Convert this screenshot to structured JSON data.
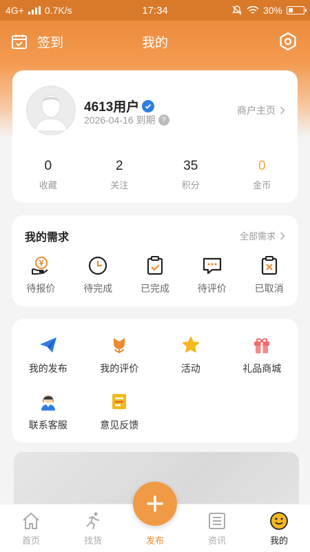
{
  "status_bar": {
    "network": "4G+",
    "speed": "0.7K/s",
    "time": "17:34",
    "battery": "30%"
  },
  "header": {
    "checkin_label": "签到",
    "title": "我的"
  },
  "profile": {
    "username": "4613用户",
    "expire_text": "2026-04-16 到期",
    "help_glyph": "?",
    "merchant_link": "商户主页",
    "stats": [
      {
        "value": "0",
        "label": "收藏"
      },
      {
        "value": "2",
        "label": "关注"
      },
      {
        "value": "35",
        "label": "积分"
      },
      {
        "value": "0",
        "label": "金币"
      }
    ]
  },
  "needs": {
    "title": "我的需求",
    "all_link": "全部需求",
    "items": [
      {
        "label": "待报价",
        "icon": "yen-hand-icon"
      },
      {
        "label": "待完成",
        "icon": "clock-icon"
      },
      {
        "label": "已完成",
        "icon": "clipboard-check-icon"
      },
      {
        "label": "待评价",
        "icon": "chat-dots-icon"
      },
      {
        "label": "已取消",
        "icon": "clipboard-x-icon"
      }
    ]
  },
  "tools": {
    "items": [
      {
        "label": "我的发布",
        "icon": "paper-plane-icon"
      },
      {
        "label": "我的评价",
        "icon": "flower-icon"
      },
      {
        "label": "活动",
        "icon": "star-icon"
      },
      {
        "label": "礼品商城",
        "icon": "gift-icon"
      },
      {
        "label": "联系客服",
        "icon": "support-agent-icon"
      },
      {
        "label": "意见反馈",
        "icon": "feedback-icon"
      }
    ]
  },
  "tabbar": {
    "items": [
      {
        "label": "首页",
        "icon": "home-icon"
      },
      {
        "label": "找货",
        "icon": "runner-icon"
      },
      {
        "label": "发布",
        "icon": "plus-icon"
      },
      {
        "label": "资讯",
        "icon": "news-icon"
      },
      {
        "label": "我的",
        "icon": "smiley-icon"
      }
    ]
  },
  "colors": {
    "accent": "#f08a2f",
    "coin": "#f0a33c",
    "verify": "#2f7de1"
  }
}
